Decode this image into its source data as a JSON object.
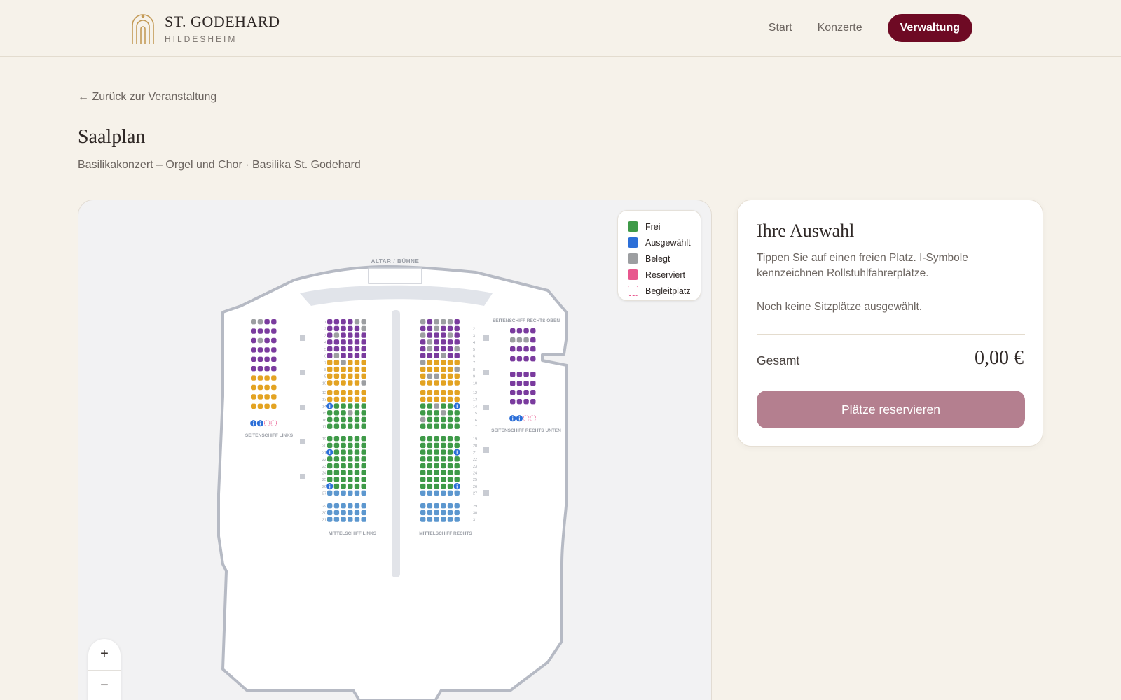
{
  "header": {
    "brand_name": "ST. GODEHARD",
    "brand_sub": "HILDESHEIM",
    "nav_start": "Start",
    "nav_concerts": "Konzerte",
    "nav_admin": "Verwaltung"
  },
  "page": {
    "back_link": "← Zurück zur Veranstaltung",
    "title": "Saalplan",
    "subtitle": "Basilikakonzert – Orgel und Chor · Basilika St. Godehard"
  },
  "map": {
    "altar_label": "ALTAR / BÜHNE",
    "sections": {
      "left_aisle": "SEITENSCHIFF LINKS",
      "nave_left": "MITTELSCHIFF LINKS",
      "nave_right": "MITTELSCHIFF RECHTS",
      "right_aisle_top": "SEITENSCHIFF RECHTS OBEN",
      "right_aisle_bottom": "SEITENSCHIFF RECHTS UNTEN"
    },
    "legend": [
      {
        "label": "Frei",
        "color": "#3e9a48"
      },
      {
        "label": "Ausgewählt",
        "color": "#2c6fd8"
      },
      {
        "label": "Belegt",
        "color": "#9c9ea1"
      },
      {
        "label": "Reserviert",
        "color": "#e8578e"
      },
      {
        "label": "Begleitplatz",
        "color": "#e8578e"
      }
    ],
    "seat_colors": {
      "purple": "#7a3b9e",
      "orange": "#e3a322",
      "green": "#3e9a48",
      "blue_light": "#5c97cf",
      "gray": "#9c9ea1",
      "wheelchair": "#2c6fd8"
    },
    "zoom_in": "+",
    "zoom_out": "−"
  },
  "selection": {
    "title": "Ihre Auswahl",
    "hint": "Tippen Sie auf einen freien Platz. I-Symbole kennzeichnen Rollstuhlfahrerplätze.",
    "empty": "Noch keine Sitzplätze ausgewählt.",
    "total_label": "Gesamt",
    "total_value": "0,00 €",
    "reserve_button": "Plätze reservieren"
  }
}
